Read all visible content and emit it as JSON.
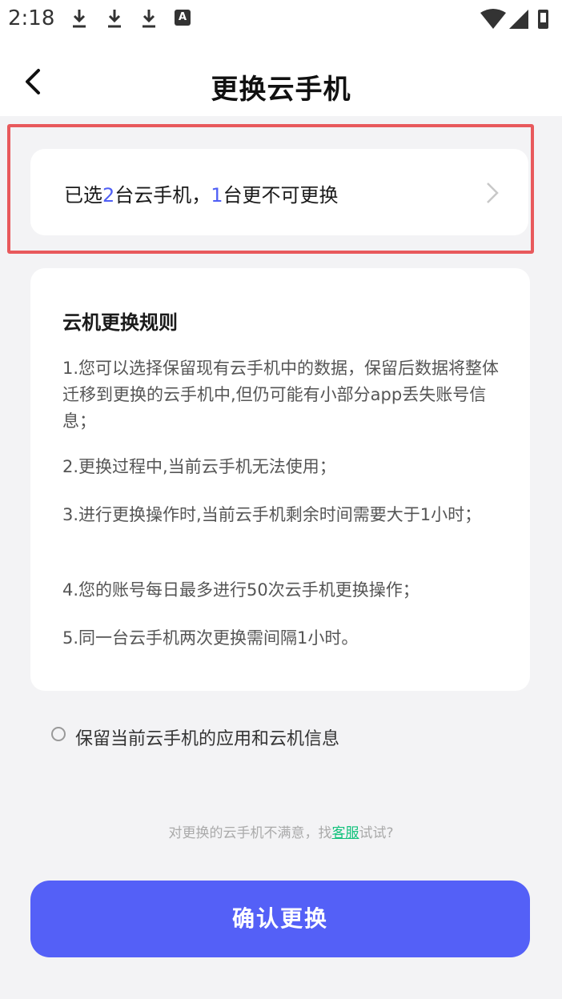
{
  "status_bar": {
    "time": "2:18",
    "icons": [
      "download-icon",
      "download-icon",
      "download-icon",
      "a-notification-icon",
      "wifi-icon",
      "signal-icon",
      "battery-icon"
    ],
    "a_glyph": "A"
  },
  "header": {
    "title": "更换云手机"
  },
  "selection": {
    "prefix": "已选",
    "selected_count": "2",
    "middle": "台云手机，",
    "unchangeable_count": "1",
    "suffix": "台更不可更换"
  },
  "rules": {
    "title": "云机更换规则",
    "items": [
      "1.您可以选择保留现有云手机中的数据，保留后数据将整体迁移到更换的云手机中,但仍可能有小部分app丢失账号信息；",
      "2.更换过程中,当前云手机无法使用；",
      "3.进行更换操作时,当前云手机剩余时间需要大于1小时；",
      "4.您的账号每日最多进行50次云手机更换操作；",
      "5.同一台云手机两次更换需间隔1小时。"
    ]
  },
  "keep_option": {
    "label": "保留当前云手机的应用和云机信息",
    "checked": false
  },
  "hint": {
    "prefix": "对更换的云手机不满意，找",
    "link": "客服",
    "suffix": "试试?"
  },
  "confirm_button": {
    "label": "确认更换"
  },
  "colors": {
    "accent": "#5460f7",
    "number_highlight": "#4f5ff5",
    "link": "#13c27c",
    "highlight_border": "#e8595c"
  }
}
